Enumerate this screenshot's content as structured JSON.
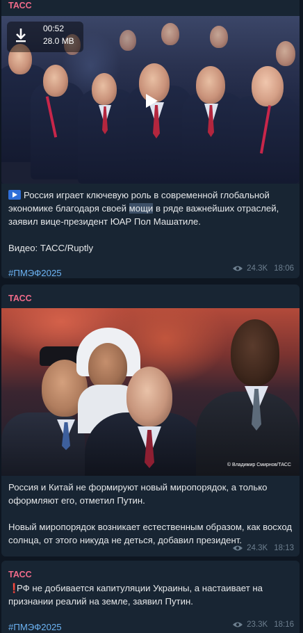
{
  "messages": [
    {
      "channel": "ТАСС",
      "video": {
        "duration": "00:52",
        "size": "28.0 MB"
      },
      "text_before": "Россия играет ключевую роль в современной глобальной экономике благодаря своей ",
      "text_highlight": "мощи",
      "text_after": " в ряде важнейших отраслей, заявил вице-президент ЮАР Пол Машатиле.",
      "text_2": "Видео: ТАСС/Ruptly",
      "hashtag": "#ПМЭФ2025",
      "views": "24.3K",
      "time": "18:06"
    },
    {
      "channel": "ТАСС",
      "photo_credit": "© Владимир Смирнов/ТАСС",
      "text_1": "Россия и Китай не формируют новый миропорядок, а только оформляют его, отметил Путин.",
      "text_2": "Новый миропорядок возникает естественным образом, как восход солнца, от этого никуда не деться, добавил президент.",
      "views": "24.3K",
      "time": "18:13"
    },
    {
      "channel": "ТАСС",
      "text": "РФ не добивается капитуляции Украины, а настаивает на признании реалий на земле, заявил Путин.",
      "hashtag": "#ПМЭФ2025",
      "views": "23.3K",
      "time": "18:16"
    }
  ],
  "icons": {
    "download": "download-icon",
    "play": "play-icon",
    "eye": "eye-icon",
    "video_badge": "video-badge-icon",
    "exclamation": "exclamation-icon"
  },
  "colors": {
    "background": "#0e1621",
    "bubble": "#182533",
    "channel": "#f06b8a",
    "hashtag": "#6cb3f3",
    "meta": "#6d7f8f"
  }
}
